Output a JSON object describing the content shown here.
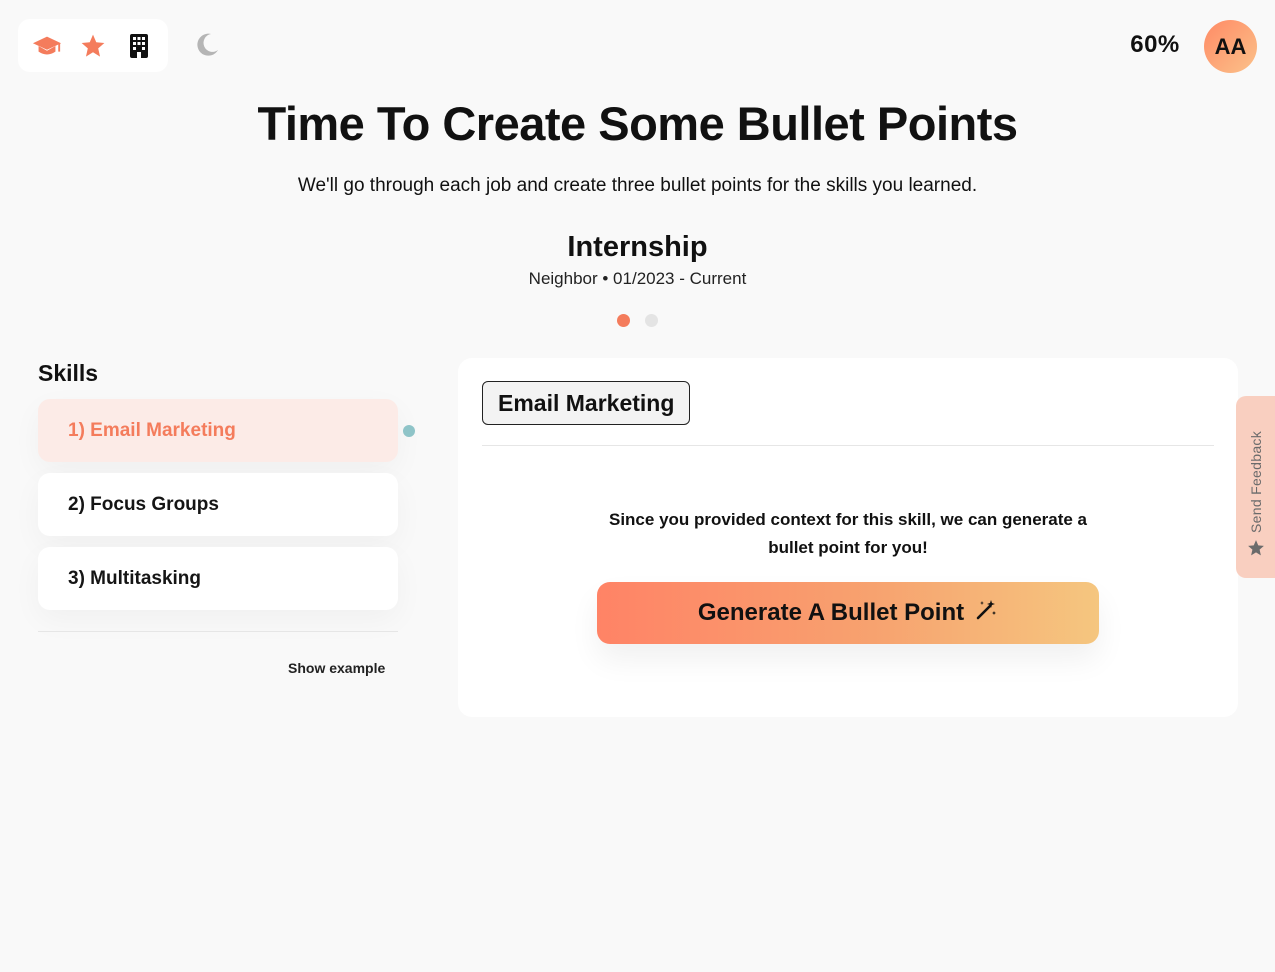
{
  "header": {
    "progress": "60%",
    "avatar_initials": "AA"
  },
  "nav": {
    "icons": [
      "graduation-cap-icon",
      "star-icon",
      "building-icon"
    ],
    "theme_toggle": "moon-icon"
  },
  "hero": {
    "title": "Time To Create Some Bullet Points",
    "subtitle": "We'll go through each job and create three bullet points for the skills you learned."
  },
  "job": {
    "title": "Internship",
    "meta": "Neighbor • 01/2023 - Current",
    "pages": 2,
    "active_page": 1
  },
  "skills": {
    "heading": "Skills",
    "items": [
      {
        "label": "1) Email Marketing",
        "active": true
      },
      {
        "label": "2) Focus Groups",
        "active": false
      },
      {
        "label": "3) Multitasking",
        "active": false
      }
    ],
    "show_example": "Show example"
  },
  "card": {
    "skill_tag": "Email Marketing",
    "message": "Since you provided context for this skill, we can generate a bullet point for you!",
    "button_label": "Generate A Bullet Point"
  },
  "feedback": {
    "label": "Send Feedback"
  },
  "colors": {
    "accent": "#f47c5c",
    "active_bg": "#fcebe7",
    "gradient_start": "#ff8366",
    "gradient_end": "#f5c67f",
    "feedback_bg": "#f9cfc0",
    "indicator": "#8fc4c8"
  }
}
